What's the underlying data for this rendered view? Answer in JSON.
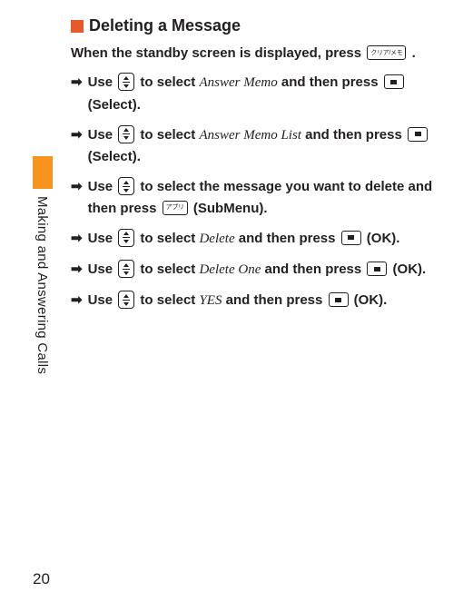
{
  "heading": "Deleting a Message",
  "lead": {
    "prefix": "When the standby screen is displayed, press ",
    "key_label": "クリア/メモ",
    "suffix": " ."
  },
  "steps": [
    {
      "parts": [
        {
          "t": "text",
          "v": "Use "
        },
        {
          "t": "key",
          "k": "updown"
        },
        {
          "t": "text",
          "v": " to select "
        },
        {
          "t": "term",
          "v": "Answer Memo"
        },
        {
          "t": "text",
          "v": " and then press "
        },
        {
          "t": "key",
          "k": "center"
        },
        {
          "t": "text",
          "v": " (Select)."
        }
      ]
    },
    {
      "parts": [
        {
          "t": "text",
          "v": "Use "
        },
        {
          "t": "key",
          "k": "updown"
        },
        {
          "t": "text",
          "v": " to select "
        },
        {
          "t": "term",
          "v": "Answer Memo List"
        },
        {
          "t": "text",
          "v": " and then press "
        },
        {
          "t": "key",
          "k": "center"
        },
        {
          "t": "text",
          "v": " (Select)."
        }
      ]
    },
    {
      "parts": [
        {
          "t": "text",
          "v": "Use "
        },
        {
          "t": "key",
          "k": "updown"
        },
        {
          "t": "text",
          "v": " to select the message you want to delete and then press "
        },
        {
          "t": "key",
          "k": "label",
          "label": "アプリ"
        },
        {
          "t": "text",
          "v": " (SubMenu)."
        }
      ]
    },
    {
      "parts": [
        {
          "t": "text",
          "v": "Use "
        },
        {
          "t": "key",
          "k": "updown"
        },
        {
          "t": "text",
          "v": " to select "
        },
        {
          "t": "term",
          "v": "Delete"
        },
        {
          "t": "text",
          "v": " and then press "
        },
        {
          "t": "key",
          "k": "center"
        },
        {
          "t": "text",
          "v": " (OK)."
        }
      ]
    },
    {
      "parts": [
        {
          "t": "text",
          "v": "Use "
        },
        {
          "t": "key",
          "k": "updown"
        },
        {
          "t": "text",
          "v": " to select "
        },
        {
          "t": "term",
          "v": "Delete One"
        },
        {
          "t": "text",
          "v": " and then press "
        },
        {
          "t": "key",
          "k": "center"
        },
        {
          "t": "text",
          "v": " (OK)."
        }
      ]
    },
    {
      "parts": [
        {
          "t": "text",
          "v": "Use "
        },
        {
          "t": "key",
          "k": "updown"
        },
        {
          "t": "text",
          "v": " to select "
        },
        {
          "t": "term",
          "v": "YES"
        },
        {
          "t": "text",
          "v": " and then press "
        },
        {
          "t": "key",
          "k": "center"
        },
        {
          "t": "text",
          "v": " (OK)."
        }
      ]
    }
  ],
  "side_label": "Making and Answering Calls",
  "page_number": "20",
  "step_arrow": "➡"
}
